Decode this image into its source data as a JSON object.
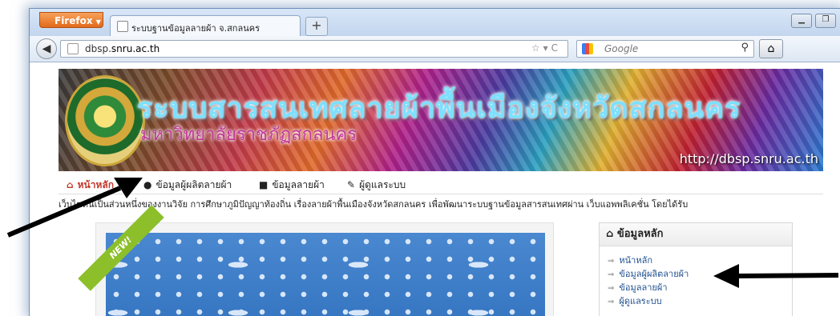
{
  "browser": {
    "app_button": "Firefox",
    "tab_title": "ระบบฐานข้อมูลลายผ้า จ.สกลนคร",
    "new_tab": "+",
    "url_host_prefix": "dbsp.",
    "url_host_main": "snru.ac.th",
    "search_placeholder": "Google",
    "controls": [
      "☆",
      "▾",
      "C"
    ]
  },
  "banner": {
    "title": "ระบบสารสนเทศลายผ้าพื้นเมืองจังหวัดสกลนคร",
    "subtitle": "มหาวิทยาลัยราชภัฏสกลนคร",
    "url": "http://dbsp.snru.ac.th"
  },
  "menu": {
    "items": [
      {
        "label": "หน้าหลัก",
        "icon": "home-icon",
        "active": true
      },
      {
        "label": "ข้อมูลผู้ผลิตลายผ้า",
        "icon": "user-icon",
        "active": false
      },
      {
        "label": "ข้อมูลลายผ้า",
        "icon": "book-icon",
        "active": false
      },
      {
        "label": "ผู้ดูแลระบบ",
        "icon": "wrench-icon",
        "active": false
      }
    ]
  },
  "marquee": "เว็บไซต์นี้เป็นส่วนหนึ่งของงานวิจัย การศึกษาภูมิปัญญาท้องถิ่น เรื่องลายผ้าพื้นเมืองจังหวัดสกลนคร เพื่อพัฒนาระบบฐานข้อมูลสารสนเทศผ่าน เว็บแอพพลิเคชั่น โดยได้รับ",
  "ribbon": "NEW!",
  "sidebox": {
    "title": "ข้อมูลหลัก",
    "links": [
      "หน้าหลัก",
      "ข้อมูลผู้ผลิตลายผ้า",
      "ข้อมูลลายผ้า",
      "ผู้ดูแลระบบ"
    ]
  }
}
